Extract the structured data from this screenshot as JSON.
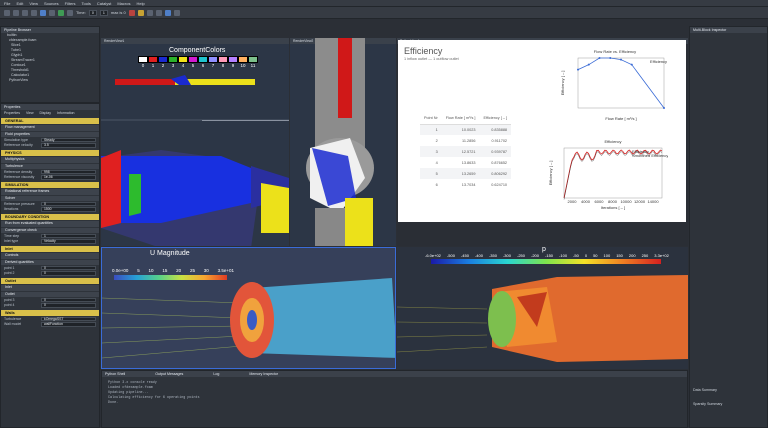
{
  "menu": [
    "File",
    "Edit",
    "View",
    "Sources",
    "Filters",
    "Tools",
    "Catalyst",
    "Macros",
    "Help"
  ],
  "toolbar": {
    "time_label": "Time:",
    "time_value": "0",
    "step_value": "1",
    "of_label": "max is 0"
  },
  "pipeline": {
    "title": "Pipeline Browser",
    "items": [
      "builtin:",
      "  cfdexample.foam",
      "    Slice1",
      "    Tube1",
      "    Glyph1",
      "    StreamTracer1",
      "    Contour1",
      "    Threshold1",
      "    Calculator1",
      "  PythonView"
    ]
  },
  "properties": {
    "title": "Properties",
    "tabs": [
      "Properties",
      "View",
      "Display",
      "Information"
    ],
    "sections": [
      "GENERAL",
      "PHYSICS",
      "SIMULATION",
      "BOUNDARY CONDITION",
      "Inlet",
      "Outlet",
      "Walls"
    ],
    "rows": [
      {
        "l": "Simulation type",
        "v": "Steady"
      },
      {
        "l": "Reference velocity",
        "v": "3.5"
      },
      {
        "l": "Reference density",
        "v": "998"
      },
      {
        "l": "Reference viscosity",
        "v": "1e-06"
      },
      {
        "l": "Reference pressure",
        "v": "0"
      },
      {
        "l": "Iterations",
        "v": "1500"
      },
      {
        "l": "Time step",
        "v": "1"
      },
      {
        "l": "Inlet type",
        "v": "Velocity"
      },
      {
        "l": "point 1",
        "v": "0"
      },
      {
        "l": "point 2",
        "v": "0"
      },
      {
        "l": "point 3",
        "v": "0"
      },
      {
        "l": "point 4",
        "v": "0"
      },
      {
        "l": "Turbulence",
        "v": "kOmegaSST"
      },
      {
        "l": "Wall model",
        "v": "wallFunction"
      }
    ],
    "groups": [
      "Flow management",
      "Fluid properties",
      "Multiphysics",
      "Turbulence",
      "Rotational reference frames",
      "Solver",
      "Run from evaluated quantities",
      "Convergence check",
      "Controls",
      "Derived quantities",
      "Inlet",
      "Outlet"
    ]
  },
  "views": {
    "top_left": "RenderView1",
    "top_mid": "RenderView2",
    "bottom_left": "RenderView3",
    "bottom_right": "RenderView4",
    "chart": "PythonView1"
  },
  "component_legend": {
    "title": "ComponentColors",
    "labels": [
      "0",
      "1",
      "2",
      "3",
      "4",
      "5",
      "6",
      "7",
      "8",
      "9",
      "10",
      "11"
    ],
    "colors": [
      "#ffffff",
      "#e02020",
      "#1a2ad0",
      "#2bb22b",
      "#f2e21a",
      "#d11ad1",
      "#20c4cf",
      "#8f8fff",
      "#ff9ab8",
      "#b380ff",
      "#ffb060",
      "#7cc08b"
    ]
  },
  "u_legend": {
    "title": "U Magnitude",
    "ticks": [
      "0.0e+00",
      "5",
      "10",
      "15",
      "20",
      "25",
      "30",
      "3.5e+01"
    ]
  },
  "p_legend": {
    "title": "p",
    "ticks": [
      "-6.0e+02",
      "-500",
      "-450",
      "-400",
      "-350",
      "-300",
      "-250",
      "-200",
      "-150",
      "-100",
      "-50",
      "0",
      "50",
      "100",
      "150",
      "200",
      "250",
      "3.3e+02"
    ]
  },
  "report": {
    "title": "Efficiency",
    "subtitle": "1 inflow outlet — 1 outflow outlet",
    "headers": [
      "Point Nr",
      "Flow Rate [ m³/s ]",
      "Efficiency [ – ]"
    ],
    "rows": [
      [
        "1",
        "10.0023",
        "0.835888"
      ],
      [
        "2",
        "11.2856",
        "0.911702"
      ],
      [
        "3",
        "12.5721",
        "0.939787"
      ],
      [
        "4",
        "13.8633",
        "0.876652"
      ],
      [
        "5",
        "13.2659",
        "0.806292"
      ],
      [
        "6",
        "13.7034",
        "0.624710"
      ]
    ]
  },
  "chart_data": [
    {
      "type": "line",
      "title": "Flow Rate  vs. Efficiency",
      "xlabel": "Flow Rate [ m³/s ]",
      "ylabel": "Efficiency [ – ]",
      "x": [
        11,
        12,
        13,
        14,
        15,
        16,
        19
      ],
      "y": [
        0.83,
        0.86,
        0.9,
        0.9,
        0.89,
        0.86,
        0.6
      ],
      "series": [
        {
          "name": "Efficiency"
        }
      ],
      "xlim": [
        11,
        19
      ],
      "ylim": [
        0.6,
        0.9
      ]
    },
    {
      "type": "line",
      "title": "Efficiency",
      "xlabel": "Iterations [ – ]",
      "ylabel": "Efficiency [ – ]",
      "xticks": [
        "2000",
        "4000",
        "6000",
        "8000",
        "10000",
        "12000",
        "14000"
      ],
      "series": [
        {
          "name": "Efficiency"
        },
        {
          "name": "Smoothed Efficiency"
        }
      ]
    }
  ],
  "output": {
    "tabs": [
      "Python Shell",
      "Output Messages",
      "Log",
      "Memory Inspector"
    ],
    "lines": [
      "Python 3.x console ready",
      "Loaded cfdexample.foam",
      "Updating pipeline...",
      "Calculating efficiency for 6 operating points",
      "Done."
    ]
  },
  "inspector": {
    "title": "Multi-Block Inspector",
    "notes": [
      "Data Summary",
      "Sparsity Summary"
    ]
  }
}
